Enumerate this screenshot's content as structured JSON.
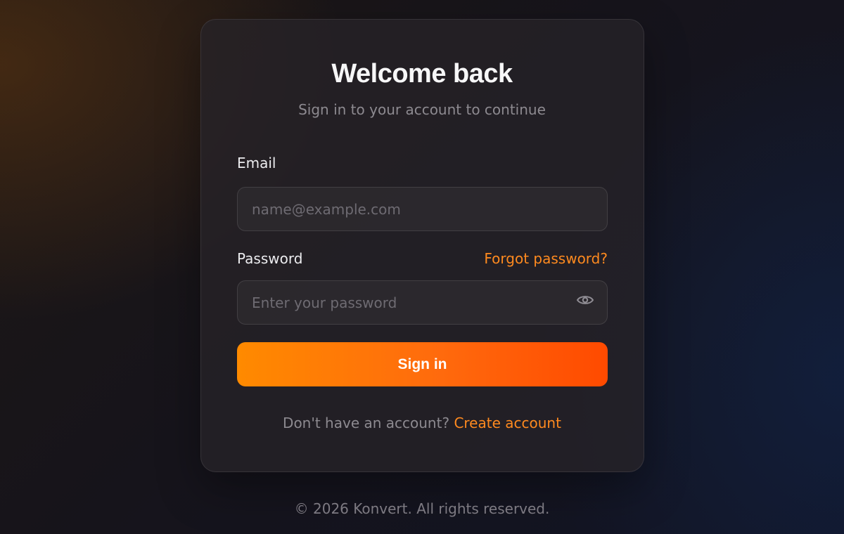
{
  "login": {
    "title": "Welcome back",
    "subtitle": "Sign in to your account to continue",
    "email": {
      "label": "Email",
      "value": "",
      "placeholder": "name@example.com"
    },
    "password": {
      "label": "Password",
      "value": "",
      "placeholder": "Enter your password",
      "forgot_label": "Forgot password?",
      "toggle_icon": "eye-icon"
    },
    "submit_label": "Sign in",
    "signup_prompt": "Don't have an account?",
    "signup_link": "Create account"
  },
  "footer": {
    "copyright": "© 2026 Konvert. All rights reserved."
  },
  "colors": {
    "accent": "#ff8a1f",
    "button_gradient_start": "#ff8a00",
    "button_gradient_end": "#ff4a00"
  }
}
